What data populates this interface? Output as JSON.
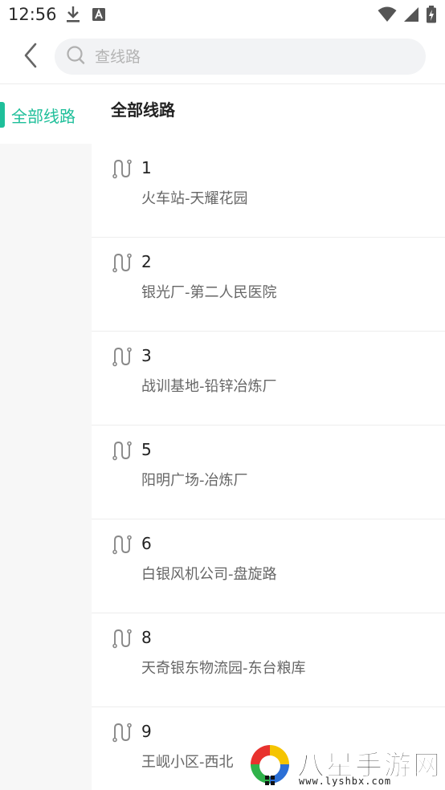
{
  "status_bar": {
    "time": "12:56",
    "left_icons": [
      "download-icon",
      "font-a-icon"
    ],
    "right_icons": [
      "wifi-icon",
      "signal-icon",
      "battery-charging-icon"
    ]
  },
  "header": {
    "back_icon": "chevron-left-icon",
    "search": {
      "icon": "search-icon",
      "placeholder": "查线路",
      "value": ""
    }
  },
  "sidebar": {
    "items": [
      {
        "label": "全部线路",
        "selected": true
      }
    ]
  },
  "main": {
    "title": "全部线路",
    "routes": [
      {
        "number": "1",
        "desc": "火车站-天耀花园"
      },
      {
        "number": "2",
        "desc": "银光厂-第二人民医院"
      },
      {
        "number": "3",
        "desc": "战训基地-铅锌冶炼厂"
      },
      {
        "number": "5",
        "desc": "阳明广场-冶炼厂"
      },
      {
        "number": "6",
        "desc": "白银风机公司-盘旋路"
      },
      {
        "number": "8",
        "desc": "天奇银东物流园-东台粮库"
      },
      {
        "number": "9",
        "desc": "王岘小区-西北"
      }
    ]
  },
  "watermark": {
    "title": "八星手游网",
    "url": "www.lyshbx.com"
  },
  "colors": {
    "accent": "#1fbf9a",
    "sidebar_bg": "#f7f7f7",
    "search_bg": "#f2f3f5",
    "divider": "#ececec"
  }
}
